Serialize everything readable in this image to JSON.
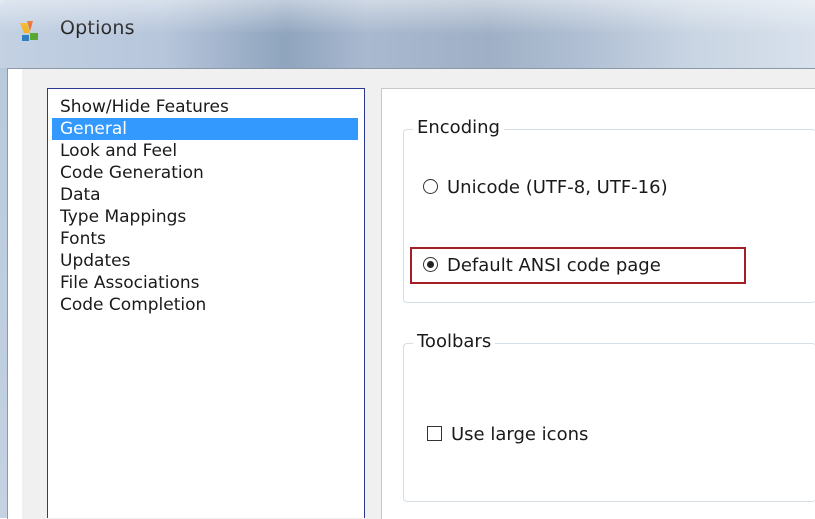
{
  "window": {
    "title": "Options",
    "icon": "options-app-icon"
  },
  "categories": {
    "selected_index": 1,
    "items": [
      {
        "label": "Show/Hide Features"
      },
      {
        "label": "General"
      },
      {
        "label": "Look and Feel"
      },
      {
        "label": "Code Generation"
      },
      {
        "label": "Data"
      },
      {
        "label": "Type Mappings"
      },
      {
        "label": "Fonts"
      },
      {
        "label": "Updates"
      },
      {
        "label": "File Associations"
      },
      {
        "label": "Code Completion"
      }
    ]
  },
  "encoding": {
    "group_label": "Encoding",
    "options": [
      {
        "label": "Unicode (UTF-8, UTF-16)",
        "checked": false
      },
      {
        "label": "Default ANSI code page",
        "checked": true
      }
    ]
  },
  "toolbars": {
    "group_label": "Toolbars",
    "large_icons_label": "Use large icons",
    "large_icons_checked": false
  },
  "colors": {
    "selection": "#3399ff",
    "highlight_box": "#a31e25",
    "list_border": "#2b3a92"
  }
}
